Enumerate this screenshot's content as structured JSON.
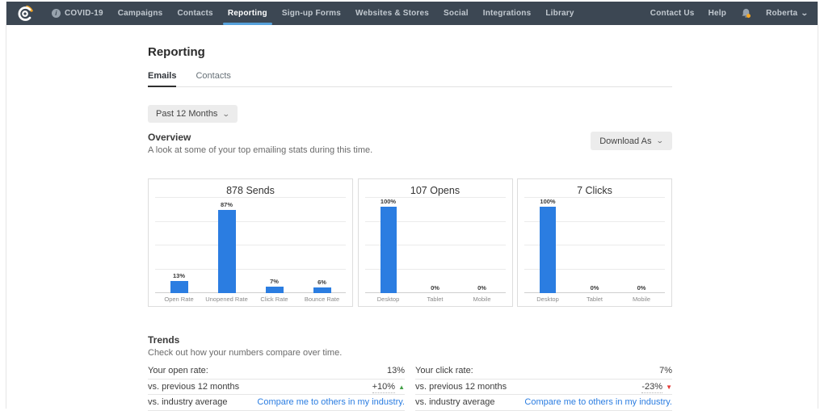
{
  "colors": {
    "nav_bg": "#3c4753",
    "nav_active_underline": "#55a0da",
    "bar_blue": "#2b7de1",
    "link_blue": "#2b7de1",
    "positive_green": "#43a047",
    "negative_red": "#e53935"
  },
  "nav": {
    "items": [
      {
        "label": "COVID-19",
        "icon": "info",
        "active": false
      },
      {
        "label": "Campaigns",
        "active": false
      },
      {
        "label": "Contacts",
        "active": false
      },
      {
        "label": "Reporting",
        "active": true
      },
      {
        "label": "Sign-up Forms",
        "active": false
      },
      {
        "label": "Websites & Stores",
        "active": false
      },
      {
        "label": "Social",
        "active": false
      },
      {
        "label": "Integrations",
        "active": false
      },
      {
        "label": "Library",
        "active": false
      }
    ],
    "right": {
      "contact_us": "Contact Us",
      "help": "Help",
      "user_name": "Roberta"
    }
  },
  "page": {
    "title": "Reporting",
    "tabs": [
      {
        "label": "Emails",
        "active": true
      },
      {
        "label": "Contacts",
        "active": false
      }
    ],
    "date_filter": "Past 12 Months"
  },
  "overview": {
    "title": "Overview",
    "subtitle": "A look at some of your top emailing stats during this time.",
    "download_button": "Download As"
  },
  "chart_data": [
    {
      "type": "bar",
      "title": "878 Sends",
      "categories": [
        "Open Rate",
        "Unopened Rate",
        "Click Rate",
        "Bounce Rate"
      ],
      "values": [
        13,
        87,
        7,
        6
      ],
      "value_labels": [
        "13%",
        "87%",
        "7%",
        "6%"
      ],
      "ylim": [
        0,
        100
      ],
      "grid": true,
      "bar_color": "#2b7de1"
    },
    {
      "type": "bar",
      "title": "107 Opens",
      "categories": [
        "Desktop",
        "Tablet",
        "Mobile"
      ],
      "values": [
        100,
        0,
        0
      ],
      "value_labels": [
        "100%",
        "0%",
        "0%"
      ],
      "ylim": [
        0,
        100
      ],
      "grid": true,
      "bar_color": "#2b7de1"
    },
    {
      "type": "bar",
      "title": "7 Clicks",
      "categories": [
        "Desktop",
        "Tablet",
        "Mobile"
      ],
      "values": [
        100,
        0,
        0
      ],
      "value_labels": [
        "100%",
        "0%",
        "0%"
      ],
      "ylim": [
        0,
        100
      ],
      "grid": true,
      "bar_color": "#2b7de1"
    }
  ],
  "trends": {
    "title": "Trends",
    "subtitle": "Check out how your numbers compare over time.",
    "tables": [
      {
        "rows": [
          {
            "label": "Your open rate:",
            "value": "13%"
          },
          {
            "label": "vs. previous 12 months",
            "value": "+10%",
            "direction": "up"
          },
          {
            "label": "vs. industry average",
            "link": "Compare me to others in my industry."
          }
        ]
      },
      {
        "rows": [
          {
            "label": "Your click rate:",
            "value": "7%"
          },
          {
            "label": "vs. previous 12 months",
            "value": "-23%",
            "direction": "down"
          },
          {
            "label": "vs. industry average",
            "link": "Compare me to others in my industry."
          }
        ]
      }
    ]
  }
}
